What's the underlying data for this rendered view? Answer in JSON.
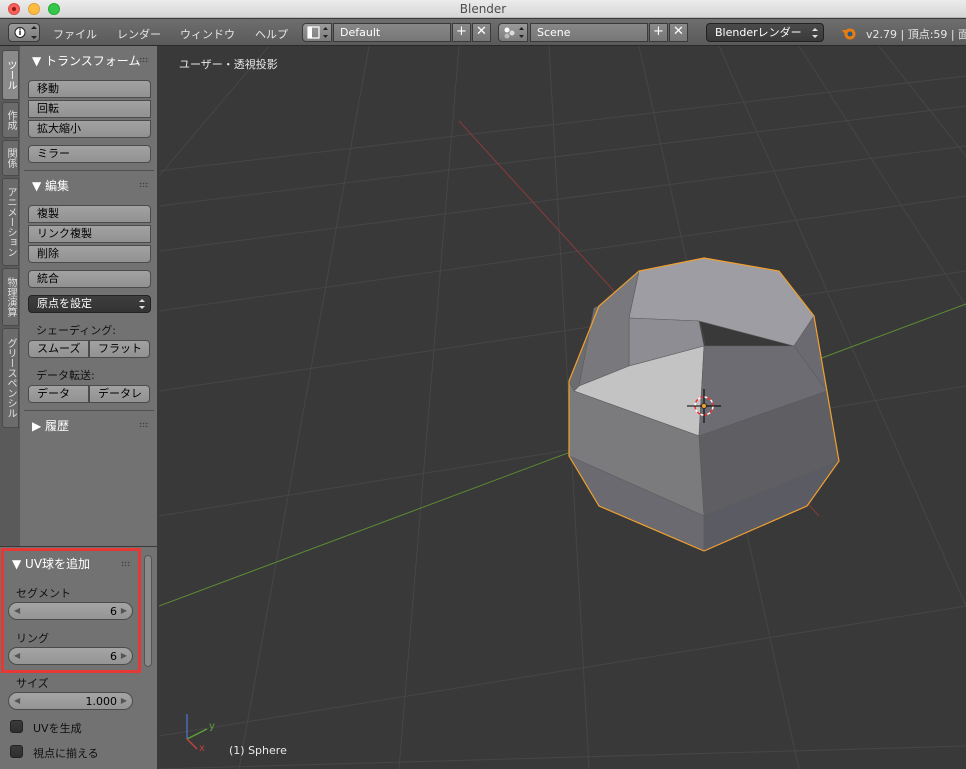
{
  "window": {
    "title": "Blender"
  },
  "header": {
    "menus": [
      "ファイル",
      "レンダー",
      "ウィンドウ",
      "ヘルプ"
    ],
    "screen_layout": "Default",
    "scene": "Scene",
    "render_engine": "Blenderレンダー",
    "status": "v2.79 | 頂点:59 | 面"
  },
  "tabs": [
    "ツール",
    "作成",
    "関係",
    "アニメーション",
    "物理演算",
    "グリースペンシル"
  ],
  "toolshelf": {
    "transform": {
      "title": "▼ トランスフォーム",
      "buttons": [
        "移動",
        "回転",
        "拡大縮小"
      ],
      "mirror": "ミラー"
    },
    "edit": {
      "title": "▼ 編集",
      "buttons": [
        "複製",
        "リンク複製",
        "削除"
      ],
      "join": "統合",
      "set_origin": "原点を設定",
      "shading_label": "シェーディング:",
      "smooth": "スムーズ",
      "flat": "フラット",
      "data_transfer_label": "データ転送:",
      "data": "データ",
      "data_layout": "データレ"
    },
    "history": {
      "title": "▶ 履歴"
    }
  },
  "operator": {
    "title": "▼ UV球を追加",
    "segments_label": "セグメント",
    "segments_value": "6",
    "rings_label": "リング",
    "rings_value": "6",
    "size_label": "サイズ",
    "size_value": "1.000",
    "gen_uv_label": "UVを生成",
    "align_view_label": "視点に揃える"
  },
  "viewport": {
    "view_label": "ユーザー・透視投影",
    "object_label": "(1) Sphere",
    "axis_x": "x",
    "axis_y": "y"
  }
}
